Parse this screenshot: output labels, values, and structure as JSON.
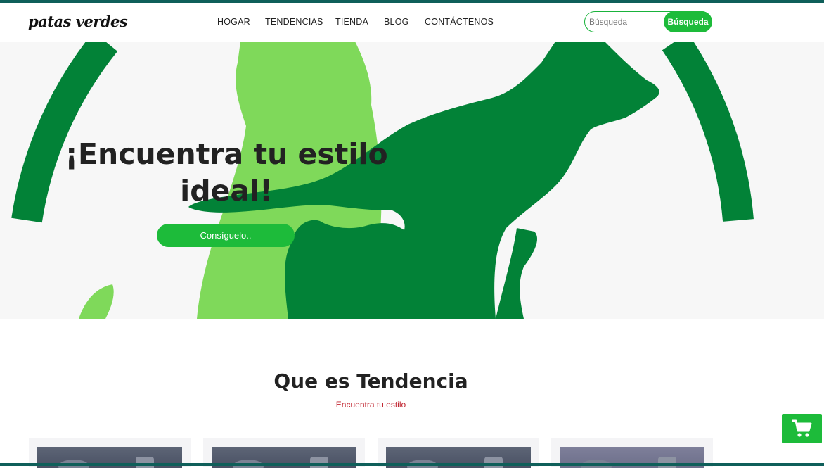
{
  "brand": {
    "name": "patas verdes"
  },
  "nav": {
    "items": [
      "HOGAR",
      "TENDENCIAS",
      "TIENDA",
      "BLOG",
      "CONTÁCTENOS"
    ]
  },
  "search": {
    "placeholder": "Búsqueda",
    "button_label": "Búsqueda"
  },
  "hero": {
    "title_line1": "¡Encuentra tu estilo",
    "title_line2": "ideal!",
    "button_label": "Consíguelo.."
  },
  "trending": {
    "title": "Que es Tendencia",
    "subtitle": "Encuentra tu estilo"
  },
  "colors": {
    "accent": "#1dbb3a",
    "dark_green": "#028237",
    "light_green": "#7fd95a",
    "frame": "#0f5f5a",
    "subtitle_red": "#c0242f"
  },
  "icons": {
    "cart": "cart-icon"
  }
}
